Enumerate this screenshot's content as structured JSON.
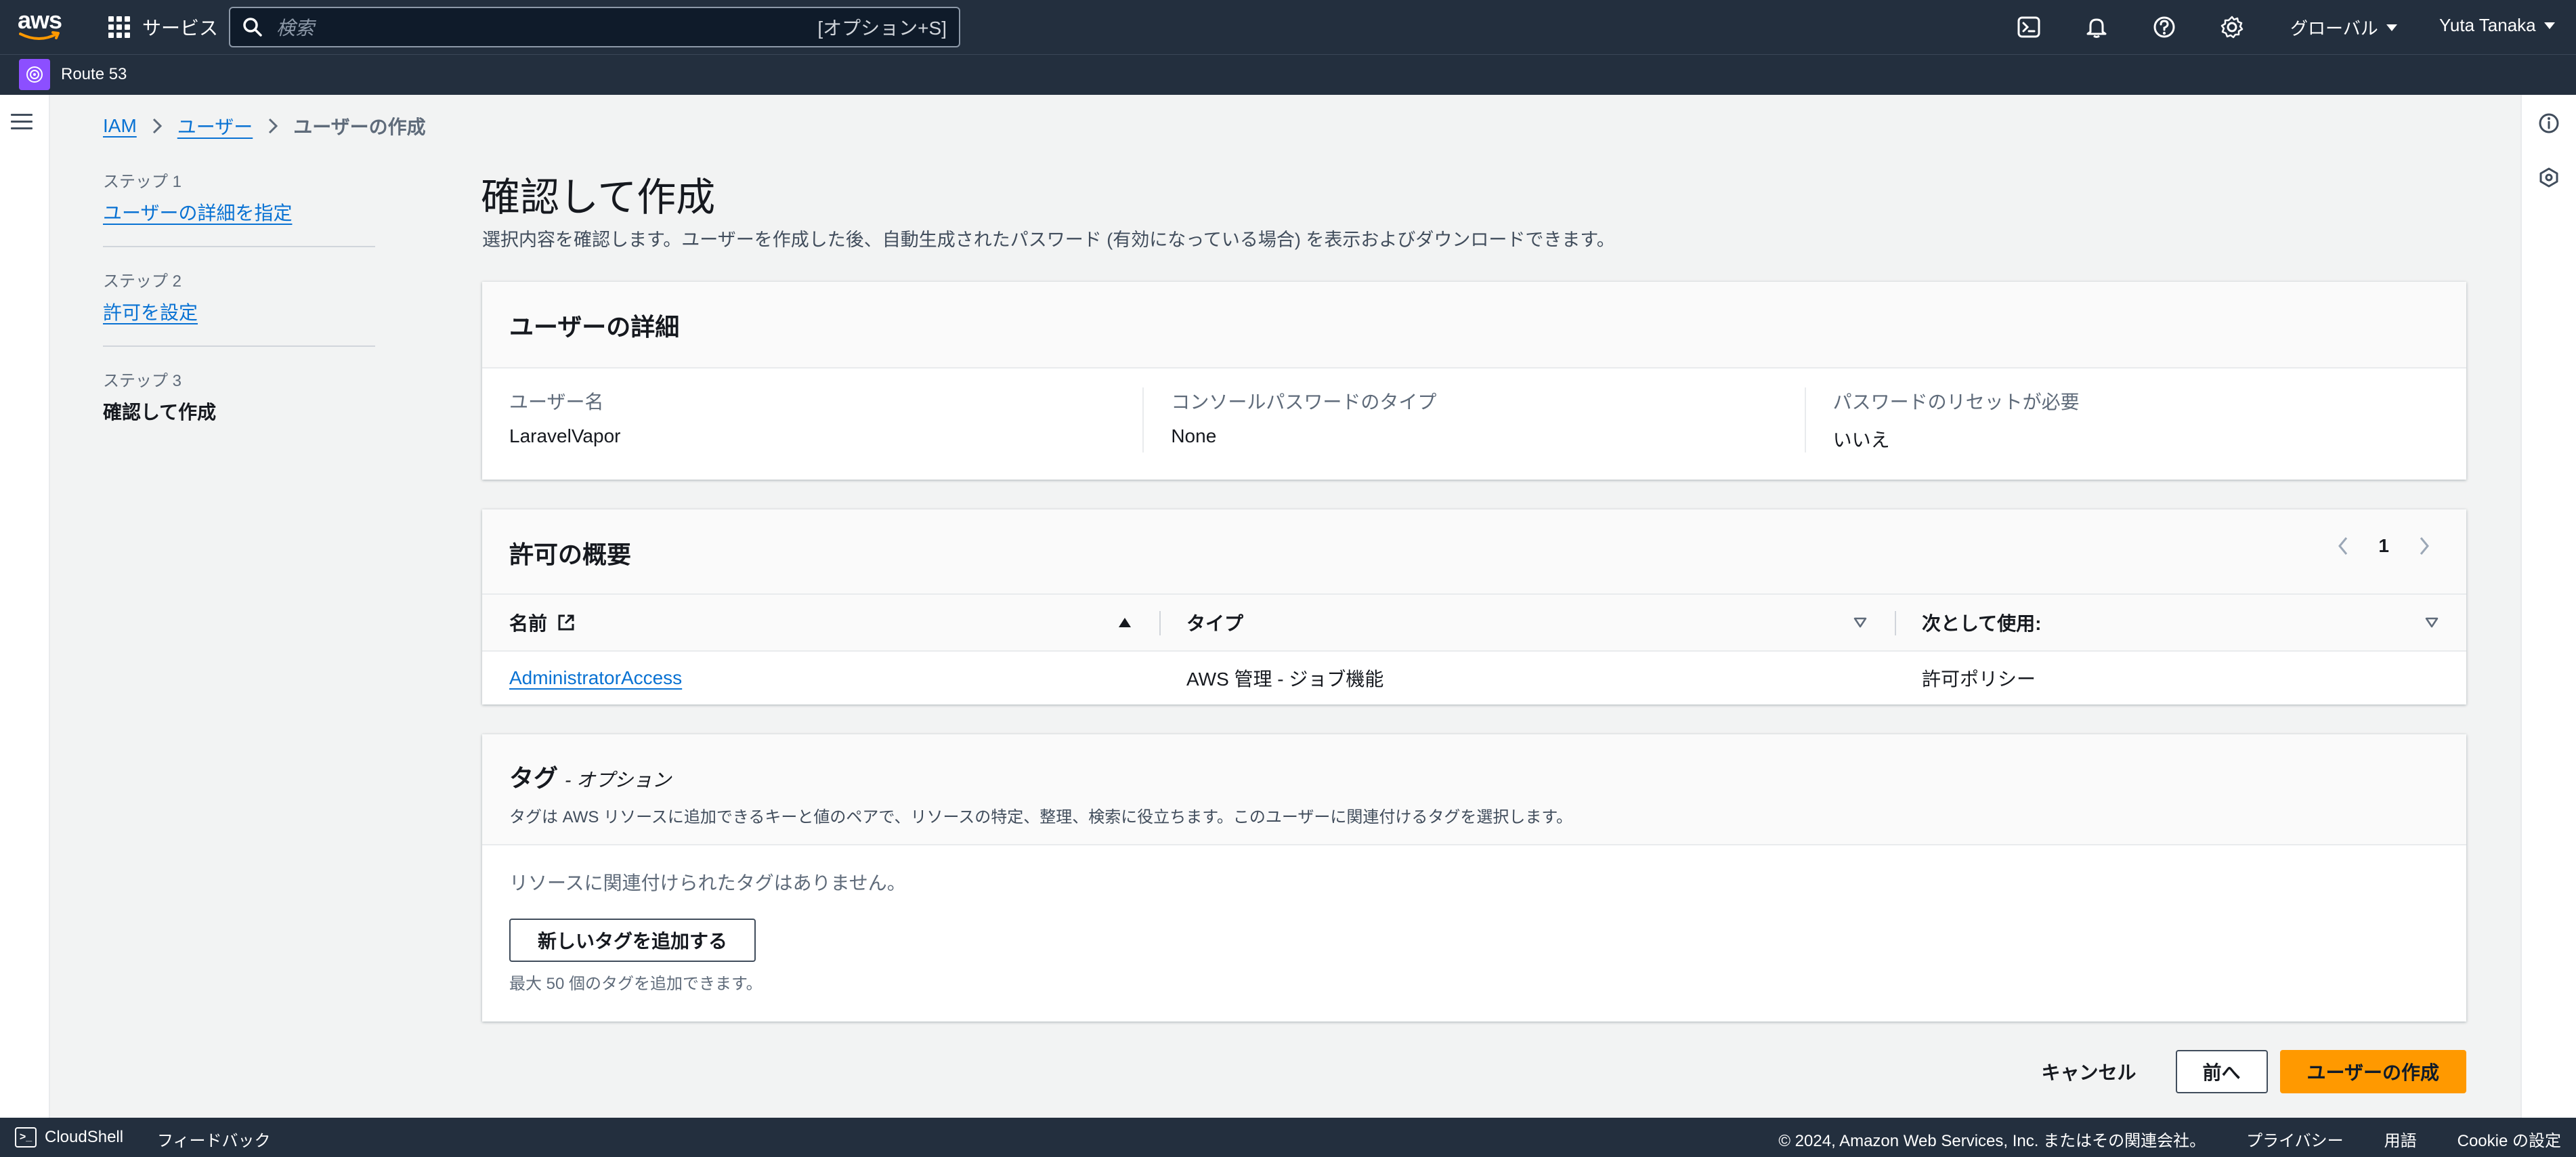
{
  "topnav": {
    "logo_text": "aws",
    "services_label": "サービス",
    "search_placeholder": "検索",
    "search_shortcut": "[オプション+S]",
    "region_label": "グローバル",
    "user_label": "Yuta Tanaka"
  },
  "subnav": {
    "service_name": "Route 53",
    "service_color": "#8c4fff"
  },
  "breadcrumb": {
    "items": [
      "IAM",
      "ユーザー"
    ],
    "current": "ユーザーの作成"
  },
  "steps": [
    {
      "label": "ステップ 1",
      "title": "ユーザーの詳細を指定"
    },
    {
      "label": "ステップ 2",
      "title": "許可を設定"
    },
    {
      "label": "ステップ 3",
      "title": "確認して作成"
    }
  ],
  "page": {
    "title": "確認して作成",
    "description": "選択内容を確認します。ユーザーを作成した後、自動生成されたパスワード (有効になっている場合) を表示およびダウンロードできます。"
  },
  "user_details": {
    "title": "ユーザーの詳細",
    "fields": [
      {
        "key": "ユーザー名",
        "value": "LaravelVapor"
      },
      {
        "key": "コンソールパスワードのタイプ",
        "value": "None"
      },
      {
        "key": "パスワードのリセットが必要",
        "value": "いいえ"
      }
    ]
  },
  "permissions": {
    "title": "許可の概要",
    "page_number": "1",
    "columns": [
      "名前",
      "タイプ",
      "次として使用:"
    ],
    "rows": [
      {
        "name": "AdministratorAccess",
        "type": "AWS 管理 - ジョブ機能",
        "used_as": "許可ポリシー"
      }
    ]
  },
  "tags": {
    "title": "タグ",
    "optional": "- オプション",
    "description": "タグは AWS リソースに追加できるキーと値のペアで、リソースの特定、整理、検索に役立ちます。このユーザーに関連付けるタグを選択します。",
    "empty_text": "リソースに関連付けられたタグはありません。",
    "add_button": "新しいタグを追加する",
    "limit_text": "最大 50 個のタグを追加できます。"
  },
  "actions": {
    "cancel": "キャンセル",
    "previous": "前へ",
    "create": "ユーザーの作成"
  },
  "footer": {
    "cloudshell": "CloudShell",
    "feedback": "フィードバック",
    "copyright": "© 2024, Amazon Web Services, Inc. またはその関連会社。",
    "privacy": "プライバシー",
    "terms": "用語",
    "cookie": "Cookie の設定"
  },
  "colors": {
    "nav_bg": "#232f3e",
    "link": "#0972d3",
    "primary_button": "#ff9900"
  }
}
